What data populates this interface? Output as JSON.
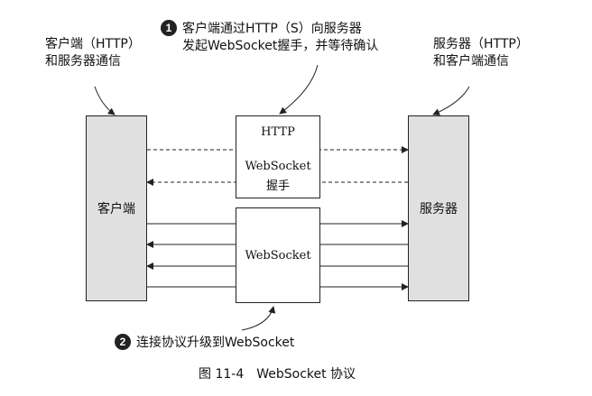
{
  "annotations": {
    "client_http_line1": "客户端（HTTP）",
    "client_http_line2": "和服务器通信",
    "server_http_line1": "服务器（HTTP）",
    "server_http_line2": "和客户端通信",
    "step1_number": "1",
    "step1_line1": "客户端通过HTTP（S）向服务器",
    "step1_line2": "发起WebSocket握手，并等待确认",
    "step2_number": "2",
    "step2_text": "连接协议升级到WebSocket"
  },
  "nodes": {
    "client": "客户端",
    "server": "服务器",
    "handshake_top": "HTTP",
    "handshake_middle": "WebSocket",
    "handshake_bottom": "握手",
    "websocket": "WebSocket"
  },
  "caption": "图 11-4　WebSocket 协议"
}
